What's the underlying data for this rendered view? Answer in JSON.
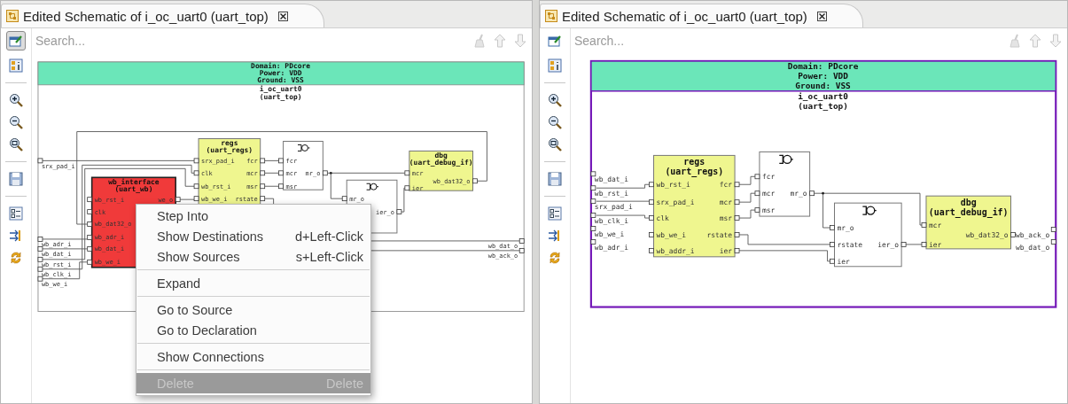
{
  "panes": [
    {
      "tab": {
        "title": "Edited Schematic of i_oc_uart0 (uart_top)"
      },
      "edit_mode_on": true,
      "search": {
        "placeholder": "Search..."
      },
      "schematic": {
        "selected": false,
        "domain": [
          "Domain: PDcore",
          "Power: VDD",
          "Ground: VSS"
        ],
        "instance": "i_oc_uart0",
        "module": "(uart_top)",
        "blocks": [
          {
            "kind": "module",
            "name": "wb_interface",
            "module": "(uart_wb)",
            "selected": true,
            "inputs": [
              "wb_rst_i",
              "clk",
              "wb_dat32_o",
              "wb_adr_i",
              "wb_dat_i",
              "wb_we_i"
            ],
            "outputs": [
              "we_o"
            ]
          },
          {
            "kind": "module",
            "name": "regs",
            "module": "(uart_regs)",
            "selected": false,
            "inputs": [
              "srx_pad_i",
              "clk",
              "wb_rst_i",
              "wb_we_i"
            ],
            "outputs": [
              "fcr",
              "mcr",
              "msr",
              "rstate"
            ]
          },
          {
            "kind": "mux",
            "inputs": [
              "fcr",
              "mcr",
              "msr"
            ],
            "outputs": [
              "mr_o"
            ]
          },
          {
            "kind": "mux",
            "inputs": [
              "mr_o"
            ],
            "outputs": [
              "ier_o"
            ]
          },
          {
            "kind": "module",
            "name": "dbg",
            "module": "(uart_debug_if)",
            "selected": false,
            "inputs": [
              "mcr",
              "ier"
            ],
            "outputs": [
              "wb_dat32_o"
            ]
          }
        ],
        "top_inputs": [
          "srx_pad_i",
          "wb_adr_i",
          "wb_dat_i",
          "wb_rst_i",
          "wb_clk_i",
          "wb_we_i"
        ],
        "top_outputs": [
          "wb_dat_o",
          "wb_ack_o"
        ]
      },
      "context_menu": {
        "groups": [
          [
            {
              "label": "Step Into",
              "disabled": false,
              "selected": false
            },
            {
              "label": "Show Destinations",
              "shortcut": "d+Left-Click",
              "disabled": false,
              "selected": false
            },
            {
              "label": "Show Sources",
              "shortcut": "s+Left-Click",
              "disabled": false,
              "selected": false
            }
          ],
          [
            {
              "label": "Expand",
              "disabled": false,
              "selected": false
            }
          ],
          [
            {
              "label": "Go to Source",
              "disabled": false,
              "selected": false
            },
            {
              "label": "Go to Declaration",
              "disabled": false,
              "selected": false
            }
          ],
          [
            {
              "label": "Show Connections",
              "disabled": false,
              "selected": false
            }
          ],
          [
            {
              "label": "Delete",
              "shortcut": "Delete",
              "disabled": true,
              "selected": true
            }
          ]
        ]
      }
    },
    {
      "tab": {
        "title": "Edited Schematic of i_oc_uart0 (uart_top)"
      },
      "edit_mode_on": false,
      "search": {
        "placeholder": "Search..."
      },
      "schematic": {
        "selected": true,
        "domain": [
          "Domain: PDcore",
          "Power: VDD",
          "Ground: VSS"
        ],
        "instance": "i_oc_uart0",
        "module": "(uart_top)",
        "blocks": [
          {
            "kind": "module",
            "name": "regs",
            "module": "(uart_regs)",
            "selected": false,
            "inputs": [
              "wb_rst_i",
              "srx_pad_i",
              "clk",
              "wb_we_i",
              "wb_addr_i"
            ],
            "outputs": [
              "fcr",
              "mcr",
              "msr",
              "rstate",
              "ier"
            ]
          },
          {
            "kind": "mux",
            "inputs": [
              "fcr",
              "mcr",
              "msr"
            ],
            "outputs": [
              "mr_o"
            ]
          },
          {
            "kind": "mux",
            "inputs": [
              "mr_o",
              "rstate",
              "ier"
            ],
            "outputs": [
              "ier_o"
            ]
          },
          {
            "kind": "module",
            "name": "dbg",
            "module": "(uart_debug_if)",
            "selected": false,
            "inputs": [
              "mcr",
              "ier"
            ],
            "outputs": [
              "wb_dat32_o"
            ]
          }
        ],
        "top_inputs": [
          "wb_dat_i",
          "wb_rst_i",
          "srx_pad_i",
          "wb_clk_i",
          "wb_we_i",
          "wb_adr_i"
        ],
        "top_outputs": [
          "wb_ack_o",
          "wb_dat_o"
        ]
      }
    }
  ]
}
